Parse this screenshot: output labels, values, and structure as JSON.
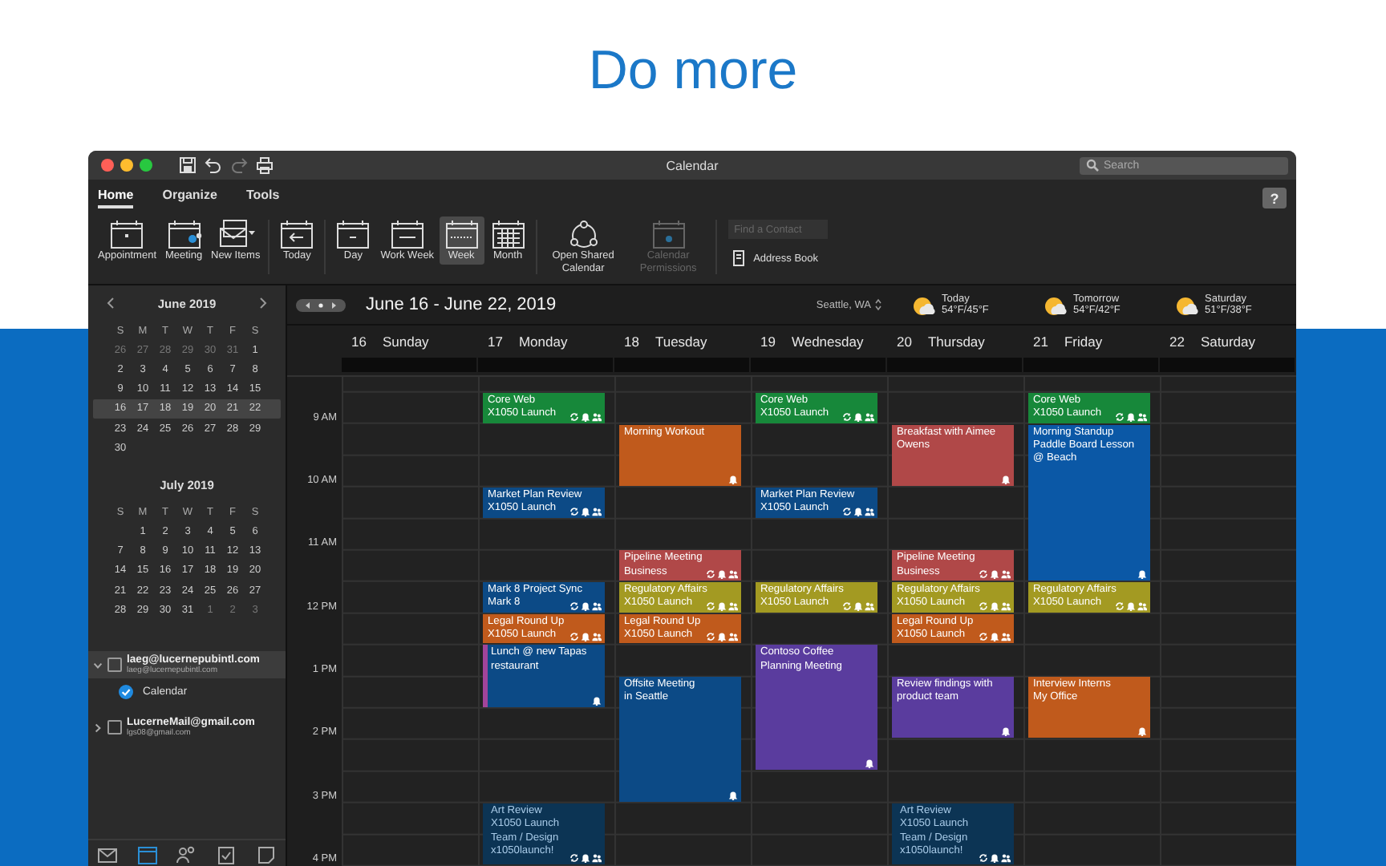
{
  "headline": "Do more",
  "window": {
    "title": "Calendar",
    "search": {
      "placeholder": "Search"
    }
  },
  "quick_tools": [
    {
      "kind": "save",
      "disabled": false
    },
    {
      "kind": "undo",
      "disabled": false
    },
    {
      "kind": "redo",
      "disabled": true
    },
    {
      "kind": "print",
      "disabled": false
    }
  ],
  "ribbon_tabs": [
    {
      "label": "Home",
      "selected": true
    },
    {
      "label": "Organize",
      "selected": false
    },
    {
      "label": "Tools",
      "selected": false
    }
  ],
  "ribbon_groups": [
    [
      {
        "kind": "appointment",
        "label": "Appointment",
        "disabled": false
      },
      {
        "kind": "meeting",
        "label": "Meeting",
        "disabled": false
      },
      {
        "kind": "new-items",
        "label": "New Items",
        "disabled": false
      }
    ],
    [
      {
        "kind": "today",
        "label": "Today",
        "disabled": false
      }
    ],
    [
      {
        "kind": "day",
        "label": "Day",
        "disabled": false,
        "selected": false
      },
      {
        "kind": "work-week",
        "label": "Work Week",
        "disabled": false,
        "selected": false
      },
      {
        "kind": "week",
        "label": "Week",
        "disabled": false,
        "selected": true
      },
      {
        "kind": "month",
        "label": "Month",
        "disabled": false,
        "selected": false
      }
    ],
    [
      {
        "kind": "shared",
        "label": "Open Shared Calendar",
        "disabled": false
      },
      {
        "kind": "permissions",
        "label": "Calendar Permissions",
        "disabled": true
      }
    ]
  ],
  "contact_search": {
    "placeholder": "Find a Contact"
  },
  "address_book": {
    "label": "Address Book"
  },
  "help": {
    "label": "?"
  },
  "mini_calendars": [
    {
      "title": "June 2019",
      "weekdays": [
        "S",
        "M",
        "T",
        "W",
        "T",
        "F",
        "S"
      ],
      "weeks": [
        {
          "selected": false,
          "days": [
            {
              "label": "26",
              "outside": true
            },
            {
              "label": "27",
              "outside": true
            },
            {
              "label": "28",
              "outside": true
            },
            {
              "label": "29",
              "outside": true
            },
            {
              "label": "30",
              "outside": true
            },
            {
              "label": "31",
              "outside": true
            },
            {
              "label": "1",
              "outside": false
            }
          ]
        },
        {
          "selected": false,
          "days": [
            {
              "label": "2",
              "outside": false
            },
            {
              "label": "3",
              "outside": false
            },
            {
              "label": "4",
              "outside": false
            },
            {
              "label": "5",
              "outside": false
            },
            {
              "label": "6",
              "outside": false
            },
            {
              "label": "7",
              "outside": false
            },
            {
              "label": "8",
              "outside": false
            }
          ]
        },
        {
          "selected": false,
          "days": [
            {
              "label": "9",
              "outside": false
            },
            {
              "label": "10",
              "outside": false
            },
            {
              "label": "11",
              "outside": false
            },
            {
              "label": "12",
              "outside": false
            },
            {
              "label": "13",
              "outside": false
            },
            {
              "label": "14",
              "outside": false
            },
            {
              "label": "15",
              "outside": false
            }
          ]
        },
        {
          "selected": true,
          "days": [
            {
              "label": "16",
              "outside": false
            },
            {
              "label": "17",
              "outside": false
            },
            {
              "label": "18",
              "outside": false
            },
            {
              "label": "19",
              "outside": false
            },
            {
              "label": "20",
              "outside": false
            },
            {
              "label": "21",
              "outside": false
            },
            {
              "label": "22",
              "outside": false
            }
          ]
        },
        {
          "selected": false,
          "days": [
            {
              "label": "23",
              "outside": false
            },
            {
              "label": "24",
              "outside": false
            },
            {
              "label": "25",
              "outside": false
            },
            {
              "label": "26",
              "outside": false
            },
            {
              "label": "27",
              "outside": false
            },
            {
              "label": "28",
              "outside": false
            },
            {
              "label": "29",
              "outside": false
            }
          ]
        },
        {
          "selected": false,
          "days": [
            {
              "label": "30",
              "outside": false
            }
          ]
        }
      ]
    },
    {
      "title": "July 2019",
      "weekdays": [
        "S",
        "M",
        "T",
        "W",
        "T",
        "F",
        "S"
      ],
      "weeks": [
        {
          "selected": false,
          "days": [
            {
              "label": "1",
              "outside": false
            },
            {
              "label": "2",
              "outside": false
            },
            {
              "label": "3",
              "outside": false
            },
            {
              "label": "4",
              "outside": false
            },
            {
              "label": "5",
              "outside": false
            },
            {
              "label": "6",
              "outside": false
            }
          ]
        },
        {
          "selected": false,
          "days": [
            {
              "label": "7",
              "outside": false
            },
            {
              "label": "8",
              "outside": false
            },
            {
              "label": "9",
              "outside": false
            },
            {
              "label": "10",
              "outside": false
            },
            {
              "label": "11",
              "outside": false
            },
            {
              "label": "12",
              "outside": false
            },
            {
              "label": "13",
              "outside": false
            }
          ]
        },
        {
          "selected": false,
          "days": [
            {
              "label": "14",
              "outside": false
            },
            {
              "label": "15",
              "outside": false
            },
            {
              "label": "16",
              "outside": false
            },
            {
              "label": "17",
              "outside": false
            },
            {
              "label": "18",
              "outside": false
            },
            {
              "label": "19",
              "outside": false
            },
            {
              "label": "20",
              "outside": false
            }
          ]
        },
        {
          "selected": false,
          "days": [
            {
              "label": "21",
              "outside": false
            },
            {
              "label": "22",
              "outside": false
            },
            {
              "label": "23",
              "outside": false
            },
            {
              "label": "24",
              "outside": false
            },
            {
              "label": "25",
              "outside": false
            },
            {
              "label": "26",
              "outside": false
            },
            {
              "label": "27",
              "outside": false
            }
          ]
        },
        {
          "selected": false,
          "days": [
            {
              "label": "28",
              "outside": false
            },
            {
              "label": "29",
              "outside": false
            },
            {
              "label": "30",
              "outside": false
            },
            {
              "label": "31",
              "outside": false
            },
            {
              "label": "1",
              "outside": true
            },
            {
              "label": "2",
              "outside": true
            },
            {
              "label": "3",
              "outside": true
            }
          ]
        }
      ]
    }
  ],
  "accounts": [
    {
      "name": "laeg@lucernepubintl.com",
      "address": "laeg@lucernepubintl.com",
      "expanded": true,
      "checked": false,
      "selected": true,
      "calendars": [
        {
          "label": "Calendar",
          "checked": true
        }
      ]
    },
    {
      "name": "LucerneMail@gmail.com",
      "address": "lgs08@gmail.com",
      "expanded": false,
      "checked": false,
      "selected": false
    }
  ],
  "nav_bar": [
    {
      "kind": "mail",
      "selected": false
    },
    {
      "kind": "calendar",
      "selected": true
    },
    {
      "kind": "people",
      "selected": false
    },
    {
      "kind": "tasks",
      "selected": false
    },
    {
      "kind": "notes",
      "selected": false
    }
  ],
  "calendar": {
    "range": "June 16 - June 22, 2019",
    "location": "Seattle, WA",
    "weather": [
      {
        "label": "Today",
        "temps": "54°F/45°F"
      },
      {
        "label": "Tomorrow",
        "temps": "54°F/42°F"
      },
      {
        "label": "Saturday",
        "temps": "51°F/38°F"
      }
    ],
    "times": [
      "9 AM",
      "10 AM",
      "11 AM",
      "12 PM",
      "1 PM",
      "2 PM",
      "3 PM",
      "4 PM"
    ],
    "days": [
      {
        "date": "16",
        "weekday": "Sunday"
      },
      {
        "date": "17",
        "weekday": "Monday",
        "slots": [
          {
            "kind": "event",
            "lines": [
              "Core Web",
              "X1050 Launch"
            ],
            "color": "#17883a",
            "recurring": true,
            "reminder": true,
            "attendees": true
          },
          {
            "kind": "free"
          },
          {
            "kind": "free"
          },
          {
            "kind": "event",
            "lines": [
              "Market Plan Review",
              "X1050 Launch"
            ],
            "color": "#0c4a86",
            "recurring": true,
            "reminder": true,
            "attendees": true
          },
          {
            "kind": "free"
          },
          {
            "kind": "free"
          },
          {
            "kind": "event",
            "lines": [
              "Mark 8 Project Sync",
              "Mark 8"
            ],
            "color": "#0c4a86",
            "recurring": true,
            "reminder": true,
            "attendees": true
          },
          {
            "kind": "event",
            "lines": [
              "Legal Round Up",
              "X1050 Launch"
            ],
            "color": "#c05a1c",
            "recurring": true,
            "reminder": true,
            "attendees": true
          },
          {
            "kind": "event",
            "lines": [
              "Lunch @ new Tapas restaurant"
            ],
            "color": "#0c4a86",
            "category": {
              "color": "#a2449a"
            },
            "recurring": false,
            "reminder": true,
            "attendees": false
          },
          {
            "kind": "continued"
          },
          {
            "kind": "free"
          },
          {
            "kind": "free"
          },
          {
            "kind": "free"
          },
          {
            "kind": "event",
            "lines": [
              "Art Review",
              "X1050 Launch",
              "Team / Design",
              "x1050launch!"
            ],
            "color": "#0c3454",
            "tentative": true,
            "recurring": true,
            "reminder": true,
            "attendees": true
          },
          {
            "kind": "continued"
          }
        ]
      },
      {
        "date": "18",
        "weekday": "Tuesday",
        "slots": [
          {
            "kind": "free"
          },
          {
            "kind": "event",
            "lines": [
              "Morning Workout"
            ],
            "color": "#c05a1c",
            "recurring": false,
            "reminder": true,
            "attendees": false
          },
          {
            "kind": "continued"
          },
          {
            "kind": "free"
          },
          {
            "kind": "free"
          },
          {
            "kind": "event",
            "lines": [
              "Pipeline Meeting",
              "Business"
            ],
            "color": "#b04848",
            "recurring": true,
            "reminder": true,
            "attendees": true
          },
          {
            "kind": "event",
            "lines": [
              "Regulatory Affairs",
              "X1050 Launch"
            ],
            "color": "#a39a22",
            "recurring": true,
            "reminder": true,
            "attendees": true
          },
          {
            "kind": "event",
            "lines": [
              "Legal Round Up",
              "X1050 Launch"
            ],
            "color": "#c05a1c",
            "recurring": true,
            "reminder": true,
            "attendees": true
          },
          {
            "kind": "free"
          },
          {
            "kind": "event",
            "lines": [
              "Offsite Meeting",
              "in Seattle"
            ],
            "color": "#0c4a86",
            "recurring": false,
            "reminder": true,
            "attendees": false
          },
          {
            "kind": "continued"
          },
          {
            "kind": "continued"
          },
          {
            "kind": "continued"
          }
        ]
      },
      {
        "date": "19",
        "weekday": "Wednesday",
        "slots": [
          {
            "kind": "event",
            "lines": [
              "Core Web",
              "X1050 Launch"
            ],
            "color": "#17883a",
            "recurring": true,
            "reminder": true,
            "attendees": true
          },
          {
            "kind": "free"
          },
          {
            "kind": "free"
          },
          {
            "kind": "event",
            "lines": [
              "Market Plan Review",
              "X1050 Launch"
            ],
            "color": "#0c4a86",
            "recurring": true,
            "reminder": true,
            "attendees": true
          },
          {
            "kind": "free"
          },
          {
            "kind": "free"
          },
          {
            "kind": "event",
            "lines": [
              "Regulatory Affairs",
              "X1050 Launch"
            ],
            "color": "#a39a22",
            "recurring": true,
            "reminder": true,
            "attendees": true
          },
          {
            "kind": "free"
          },
          {
            "kind": "event",
            "lines": [
              "Contoso Coffee Planning Meeting"
            ],
            "color": "#5a3c9e",
            "recurring": false,
            "reminder": true,
            "attendees": false
          },
          {
            "kind": "continued"
          },
          {
            "kind": "continued"
          },
          {
            "kind": "continued"
          }
        ]
      },
      {
        "date": "20",
        "weekday": "Thursday",
        "slots": [
          {
            "kind": "free"
          },
          {
            "kind": "event",
            "lines": [
              "Breakfast with Aimee Owens"
            ],
            "color": "#b04848",
            "recurring": false,
            "reminder": true,
            "attendees": false
          },
          {
            "kind": "continued"
          },
          {
            "kind": "free"
          },
          {
            "kind": "free"
          },
          {
            "kind": "event",
            "lines": [
              "Pipeline Meeting",
              "Business"
            ],
            "color": "#b04848",
            "recurring": true,
            "reminder": true,
            "attendees": true
          },
          {
            "kind": "event",
            "lines": [
              "Regulatory Affairs",
              "X1050 Launch"
            ],
            "color": "#a39a22",
            "recurring": true,
            "reminder": true,
            "attendees": true
          },
          {
            "kind": "event",
            "lines": [
              "Legal Round Up",
              "X1050 Launch"
            ],
            "color": "#c05a1c",
            "recurring": true,
            "reminder": true,
            "attendees": true
          },
          {
            "kind": "free"
          },
          {
            "kind": "event",
            "lines": [
              "Review findings with product team"
            ],
            "color": "#5a3c9e",
            "recurring": false,
            "reminder": true,
            "attendees": false
          },
          {
            "kind": "continued"
          },
          {
            "kind": "free"
          },
          {
            "kind": "free"
          },
          {
            "kind": "event",
            "lines": [
              "Art Review",
              "X1050 Launch",
              "Team / Design",
              "x1050launch!"
            ],
            "color": "#0c3454",
            "tentative": true,
            "recurring": true,
            "reminder": true,
            "attendees": true
          },
          {
            "kind": "continued"
          }
        ]
      },
      {
        "date": "21",
        "weekday": "Friday",
        "slots": [
          {
            "kind": "event",
            "lines": [
              "Core Web",
              "X1050 Launch"
            ],
            "color": "#17883a",
            "recurring": true,
            "reminder": true,
            "attendees": true
          },
          {
            "kind": "event",
            "lines": [
              "Morning Standup",
              "Paddle Board Lesson @ Beach"
            ],
            "color": "#0b58a6",
            "recurring": false,
            "reminder": true,
            "attendees": false
          },
          {
            "kind": "continued"
          },
          {
            "kind": "continued"
          },
          {
            "kind": "continued"
          },
          {
            "kind": "continued"
          },
          {
            "kind": "event",
            "lines": [
              "Regulatory Affairs",
              "X1050 Launch"
            ],
            "color": "#a39a22",
            "recurring": true,
            "reminder": true,
            "attendees": true
          },
          {
            "kind": "free"
          },
          {
            "kind": "free"
          },
          {
            "kind": "event",
            "lines": [
              "Interview Interns",
              "My Office"
            ],
            "color": "#c05a1c",
            "recurring": false,
            "reminder": true,
            "attendees": false
          },
          {
            "kind": "continued"
          }
        ]
      },
      {
        "date": "22",
        "weekday": "Saturday"
      }
    ]
  }
}
